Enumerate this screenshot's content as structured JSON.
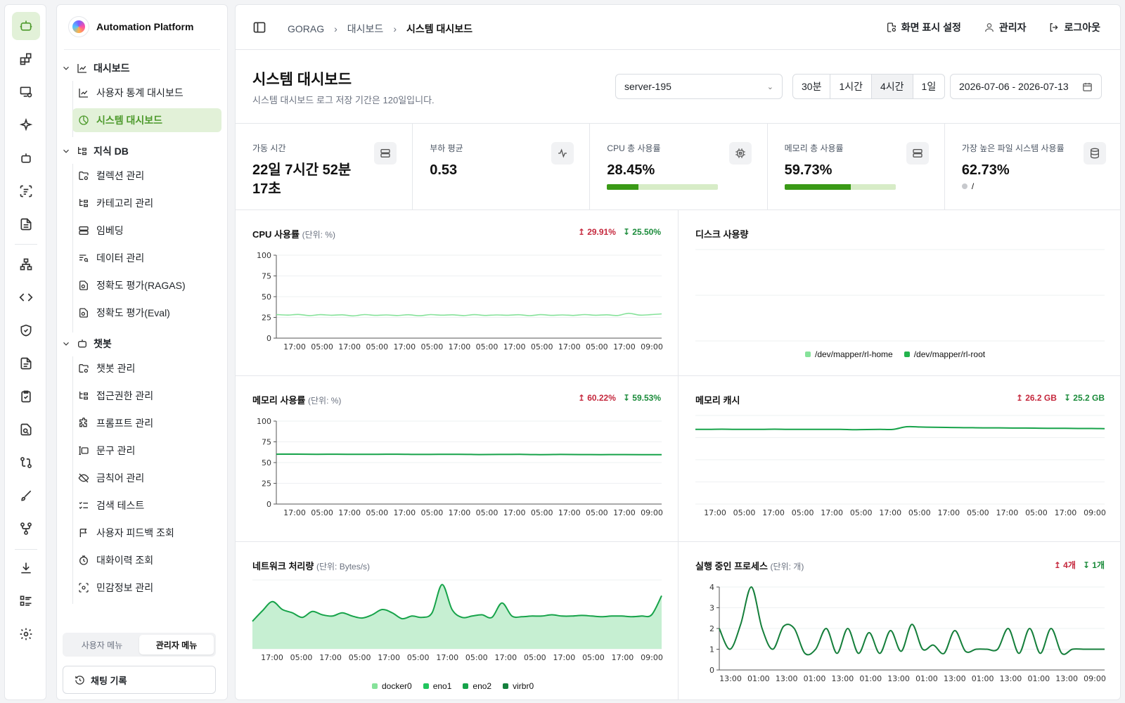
{
  "sidebar": {
    "brand": "Automation Platform",
    "groups": [
      {
        "label": "대시보드"
      },
      {
        "label": "지식 DB"
      },
      {
        "label": "챗봇"
      }
    ],
    "items": [
      {
        "label": "사용자 통계 대시보드"
      },
      {
        "label": "시스템 대시보드"
      },
      {
        "label": "컬렉션 관리"
      },
      {
        "label": "카테고리 관리"
      },
      {
        "label": "임베딩"
      },
      {
        "label": "데이터 관리"
      },
      {
        "label": "정확도 평가(RAGAS)"
      },
      {
        "label": "정확도 평가(Eval)"
      },
      {
        "label": "챗봇 관리"
      },
      {
        "label": "접근권한 관리"
      },
      {
        "label": "프롬프트 관리"
      },
      {
        "label": "문구 관리"
      },
      {
        "label": "금칙어 관리"
      },
      {
        "label": "검색 테스트"
      },
      {
        "label": "사용자 피드백 조회"
      },
      {
        "label": "대화이력 조회"
      },
      {
        "label": "민감정보 관리"
      }
    ],
    "menu_toggle": {
      "user": "사용자 메뉴",
      "admin": "관리자 메뉴"
    },
    "chat_history": "채팅 기록"
  },
  "header": {
    "breadcrumb": [
      "GORAG",
      "대시보드",
      "시스템 대시보드"
    ],
    "display_settings": "화면 표시 설정",
    "user": "관리자",
    "logout": "로그아웃"
  },
  "page": {
    "title": "시스템 대시보드",
    "subtitle": "시스템 대시보드 로그 저장 기간은 120일입니다.",
    "server": "server-195",
    "ranges": [
      "30분",
      "1시간",
      "4시간",
      "1일"
    ],
    "selected_range": "4시간",
    "date_range": "2026-07-06 - 2026-07-13"
  },
  "stats": {
    "uptime": {
      "label": "가동 시간",
      "value_line1": "22일 7시간 52분",
      "value_line2": "17초"
    },
    "load": {
      "label": "부하 평균",
      "value": "0.53"
    },
    "cpu": {
      "label": "CPU 총 사용률",
      "value": "28.45%",
      "percent": 28.45
    },
    "memory": {
      "label": "메모리 총 사용률",
      "value": "59.73%",
      "percent": 59.73
    },
    "fs": {
      "label": "가장 높은 파일 시스템 사용률",
      "value": "62.73%",
      "mount": "/"
    }
  },
  "colors": {
    "accent": "#4d9a2c",
    "up": "#c5283d",
    "down": "#1a8b3a",
    "line_light": "#86e29a",
    "line_dark": "#17a34a"
  },
  "chart_data": [
    {
      "id": "cpu",
      "type": "line",
      "title": "CPU 사용률",
      "unit": "(단위: %)",
      "max": "29.91%",
      "min": "25.50%",
      "ylim": [
        0,
        100
      ],
      "yticks": [
        0,
        25,
        50,
        75,
        100
      ],
      "xticks": [
        "17:00",
        "05:00",
        "17:00",
        "05:00",
        "17:00",
        "05:00",
        "17:00",
        "05:00",
        "17:00",
        "05:00",
        "17:00",
        "05:00",
        "17:00",
        "09:00"
      ],
      "series": [
        {
          "values": [
            28.5,
            27.8,
            28.6,
            27.2,
            28.3,
            27.6,
            28.1,
            26.9,
            28.4,
            27.5,
            28.0,
            27.3,
            28.2,
            27.0,
            28.4,
            27.7,
            28.1,
            27.2,
            28.3,
            27.4,
            28.0,
            27.6,
            28.2,
            27.1,
            28.3,
            27.5,
            28.0,
            27.4,
            28.4,
            27.6,
            28.1,
            27.3,
            29.9,
            27.8,
            28.3,
            29.2
          ]
        }
      ]
    },
    {
      "id": "disk",
      "type": "line",
      "title": "디스크 사용량",
      "legend": [
        "/dev/mapper/rl-home",
        "/dev/mapper/rl-root"
      ]
    },
    {
      "id": "mem",
      "type": "line",
      "title": "메모리 사용률",
      "unit": "(단위: %)",
      "max": "60.22%",
      "min": "59.53%",
      "ylim": [
        0,
        100
      ],
      "yticks": [
        0,
        25,
        50,
        75,
        100
      ],
      "xticks": [
        "17:00",
        "05:00",
        "17:00",
        "05:00",
        "17:00",
        "05:00",
        "17:00",
        "05:00",
        "17:00",
        "05:00",
        "17:00",
        "05:00",
        "17:00",
        "09:00"
      ],
      "series": [
        {
          "values": [
            60.1,
            60.2,
            60.0,
            60.1,
            59.9,
            60.0,
            60.1,
            59.8,
            59.9,
            60.0,
            59.7,
            59.8,
            59.9,
            59.6,
            59.8,
            59.7,
            59.6,
            59.7,
            59.5,
            59.6
          ]
        }
      ]
    },
    {
      "id": "cache",
      "type": "line",
      "title": "메모리 캐시",
      "max": "26.2 GB",
      "min": "25.2 GB",
      "ylim": [
        0,
        30
      ],
      "xticks": [
        "17:00",
        "05:00",
        "17:00",
        "05:00",
        "17:00",
        "05:00",
        "17:00",
        "05:00",
        "17:00",
        "05:00",
        "17:00",
        "05:00",
        "17:00",
        "09:00"
      ],
      "series": [
        {
          "values": [
            25.3,
            25.3,
            25.35,
            25.3,
            25.3,
            25.3,
            25.35,
            25.3,
            25.3,
            25.3,
            25.3,
            25.3,
            25.2,
            25.25,
            25.3,
            25.3,
            26.2,
            26.1,
            26.0,
            25.95,
            25.9,
            25.85,
            25.8,
            25.8,
            25.75,
            25.75,
            25.7,
            25.65,
            25.65,
            25.6,
            25.6,
            25.55
          ]
        }
      ]
    },
    {
      "id": "net",
      "type": "area",
      "title": "네트워크 처리량",
      "unit": "(단위: Bytes/s)",
      "xticks": [
        "17:00",
        "05:00",
        "17:00",
        "05:00",
        "17:00",
        "05:00",
        "17:00",
        "05:00",
        "17:00",
        "05:00",
        "17:00",
        "05:00",
        "17:00",
        "09:00"
      ],
      "legend": [
        "docker0",
        "eno1",
        "eno2",
        "virbr0"
      ],
      "series": [
        {
          "name": "eno1",
          "values": [
            0.42,
            0.58,
            0.72,
            0.6,
            0.55,
            0.48,
            0.57,
            0.52,
            0.5,
            0.55,
            0.5,
            0.47,
            0.52,
            0.6,
            0.55,
            0.46,
            0.5,
            0.48,
            0.55,
            0.98,
            0.6,
            0.48,
            0.5,
            0.52,
            0.48,
            0.7,
            0.5,
            0.49,
            0.5,
            0.5,
            0.52,
            0.5,
            0.5,
            0.51,
            0.5,
            0.49,
            0.5,
            0.5,
            0.49,
            0.5,
            0.52,
            0.81
          ]
        }
      ]
    },
    {
      "id": "proc",
      "type": "line",
      "title": "실행 중인 프로세스",
      "unit": "(단위: 개)",
      "max": "4개",
      "min": "1개",
      "ylim": [
        0,
        4
      ],
      "yticks": [
        0,
        1,
        2,
        3,
        4
      ],
      "xticks": [
        "13:00",
        "01:00",
        "13:00",
        "01:00",
        "13:00",
        "01:00",
        "13:00",
        "01:00",
        "13:00",
        "01:00",
        "13:00",
        "01:00",
        "13:00",
        "09:00"
      ],
      "series": [
        {
          "values": [
            2.0,
            1.0,
            2.2,
            4.0,
            2.0,
            1.0,
            2.1,
            2.0,
            0.8,
            1.0,
            2.0,
            0.8,
            2.0,
            0.8,
            1.8,
            0.8,
            1.9,
            0.9,
            2.2,
            1.0,
            1.2,
            0.8,
            1.9,
            0.9,
            1.0,
            1.0,
            1.0,
            2.0,
            0.8,
            2.0,
            0.8,
            2.0,
            0.8,
            1.0,
            1.0,
            1.0,
            1.0
          ]
        }
      ]
    }
  ]
}
